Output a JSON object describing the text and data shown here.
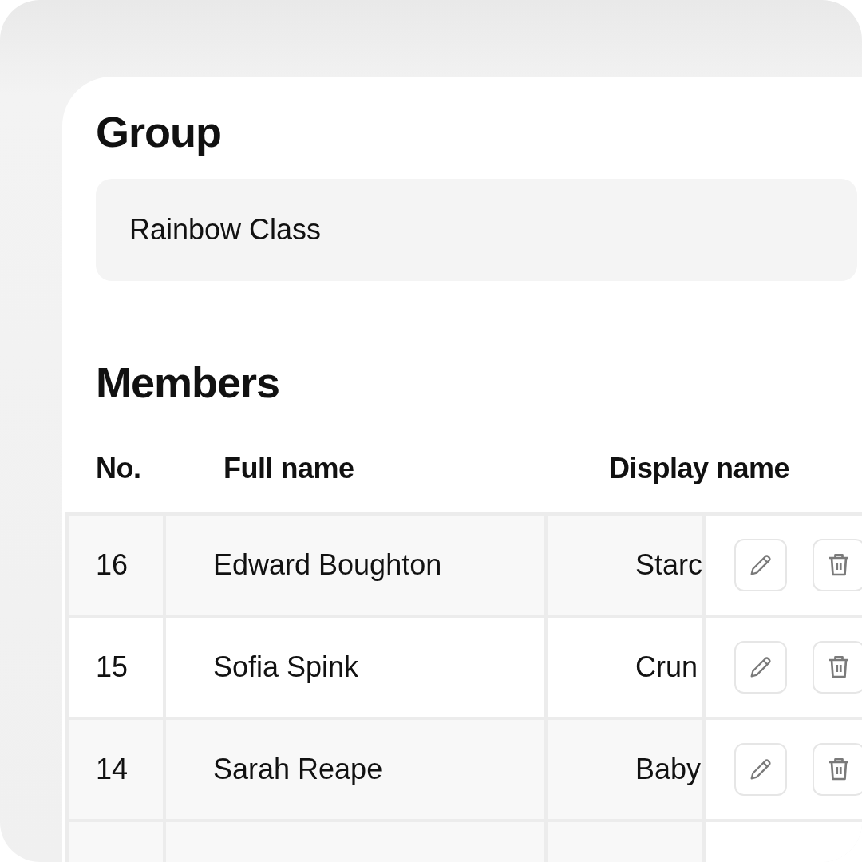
{
  "group": {
    "heading": "Group",
    "field_value": "Rainbow Class"
  },
  "members": {
    "heading": "Members",
    "columns": [
      "No.",
      "Full name",
      "Display name"
    ],
    "rows": [
      {
        "number": "16",
        "full_name": "Edward Boughton",
        "display_name": "Starc"
      },
      {
        "number": "15",
        "full_name": "Sofia Spink",
        "display_name": "Crun"
      },
      {
        "number": "14",
        "full_name": "Sarah Reape",
        "display_name": "Baby"
      }
    ]
  }
}
